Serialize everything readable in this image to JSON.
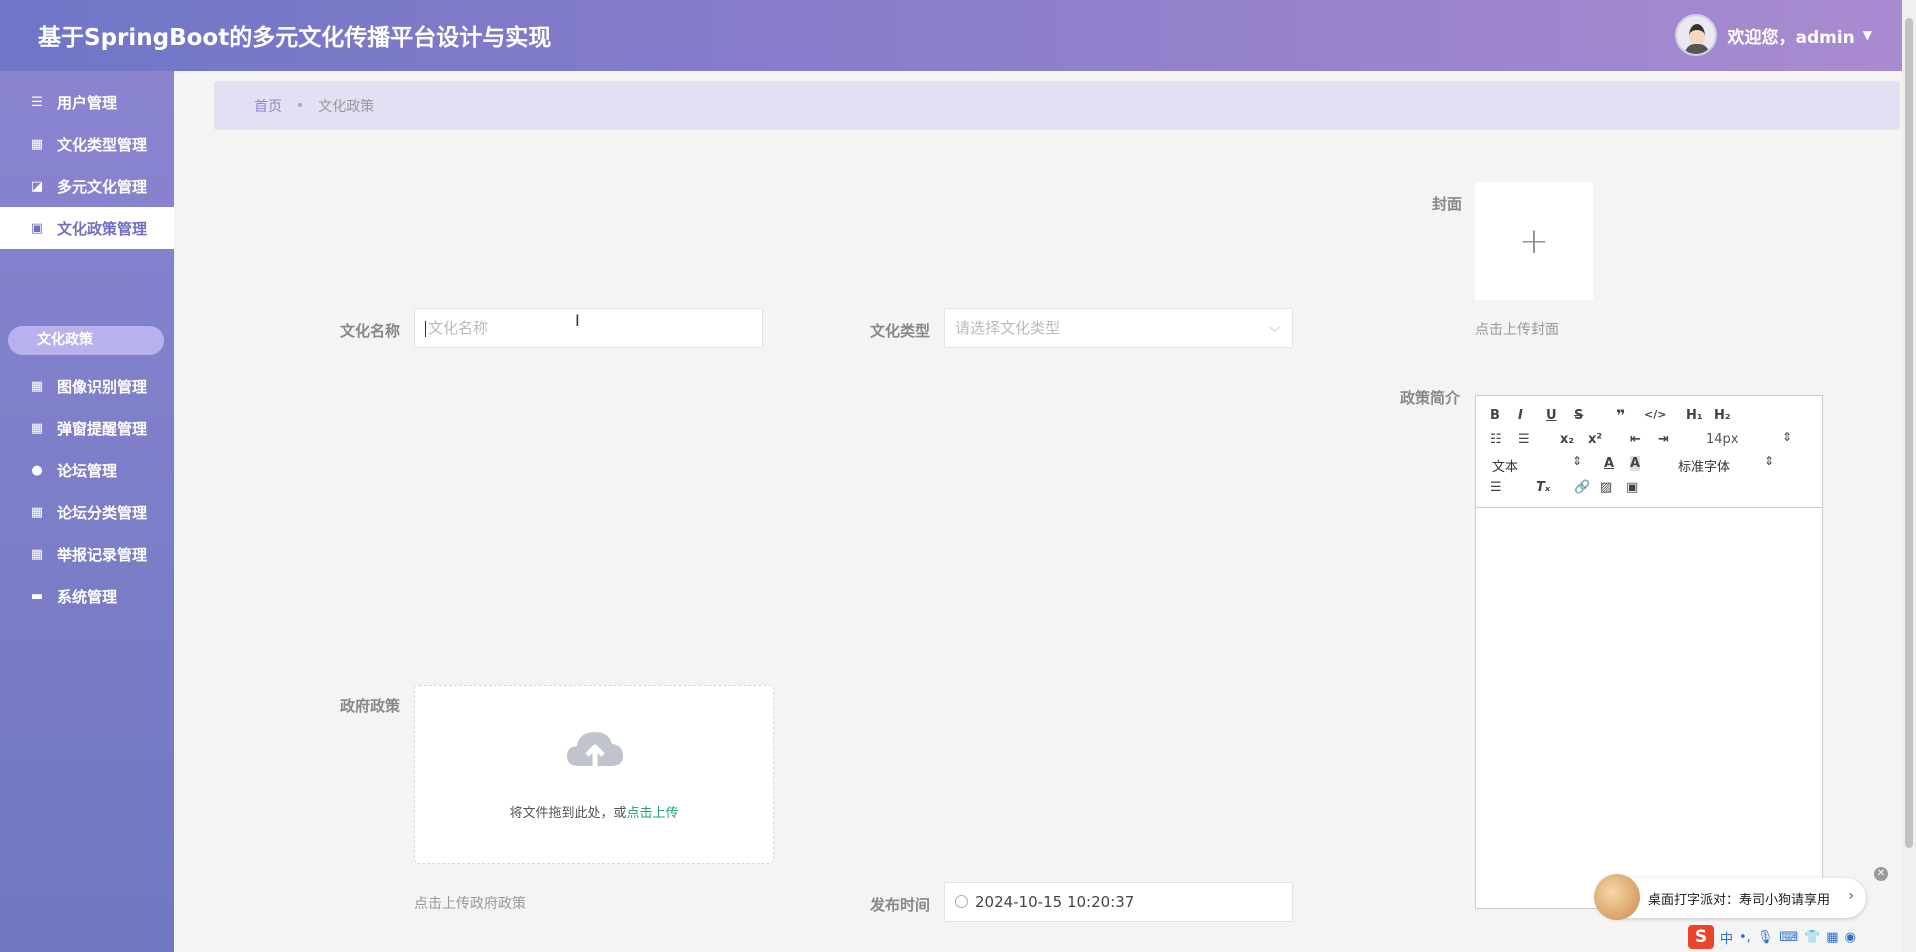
{
  "header": {
    "title": "基于SpringBoot的多元文化传播平台设计与实现",
    "welcome": "欢迎您，admin"
  },
  "sidebar": {
    "items": [
      {
        "label": "用户管理",
        "icon": "list-icon"
      },
      {
        "label": "文化类型管理",
        "icon": "grid-icon"
      },
      {
        "label": "多元文化管理",
        "icon": "chart-icon"
      },
      {
        "label": "文化政策管理",
        "icon": "clipboard-icon",
        "active": true
      },
      {
        "label": "图像识别管理",
        "icon": "grid-icon"
      },
      {
        "label": "弹窗提醒管理",
        "icon": "grid-icon"
      },
      {
        "label": "论坛管理",
        "icon": "user-icon"
      },
      {
        "label": "论坛分类管理",
        "icon": "grid-icon"
      },
      {
        "label": "举报记录管理",
        "icon": "grid-icon"
      },
      {
        "label": "系统管理",
        "icon": "briefcase-icon"
      }
    ],
    "sub_item": "文化政策"
  },
  "breadcrumb": {
    "home": "首页",
    "current": "文化政策"
  },
  "form": {
    "cover_label": "封面",
    "cover_hint": "点击上传封面",
    "name_label": "文化名称",
    "name_placeholder": "文化名称",
    "type_label": "文化类型",
    "type_placeholder": "请选择文化类型",
    "intro_label": "政策简介",
    "policy_label": "政府政策",
    "upload_text": "将文件拖到此处，或",
    "upload_link": "点击上传",
    "policy_hint": "点击上传政府政策",
    "publish_label": "发布时间",
    "publish_value": "2024-10-15 10:20:37"
  },
  "editor": {
    "font_size": "14px",
    "text_style": "文本",
    "font_family": "标准字体"
  },
  "toast": {
    "text": "桌面打字派对：寿司小狗请享用"
  },
  "ime": {
    "lang": "中"
  }
}
